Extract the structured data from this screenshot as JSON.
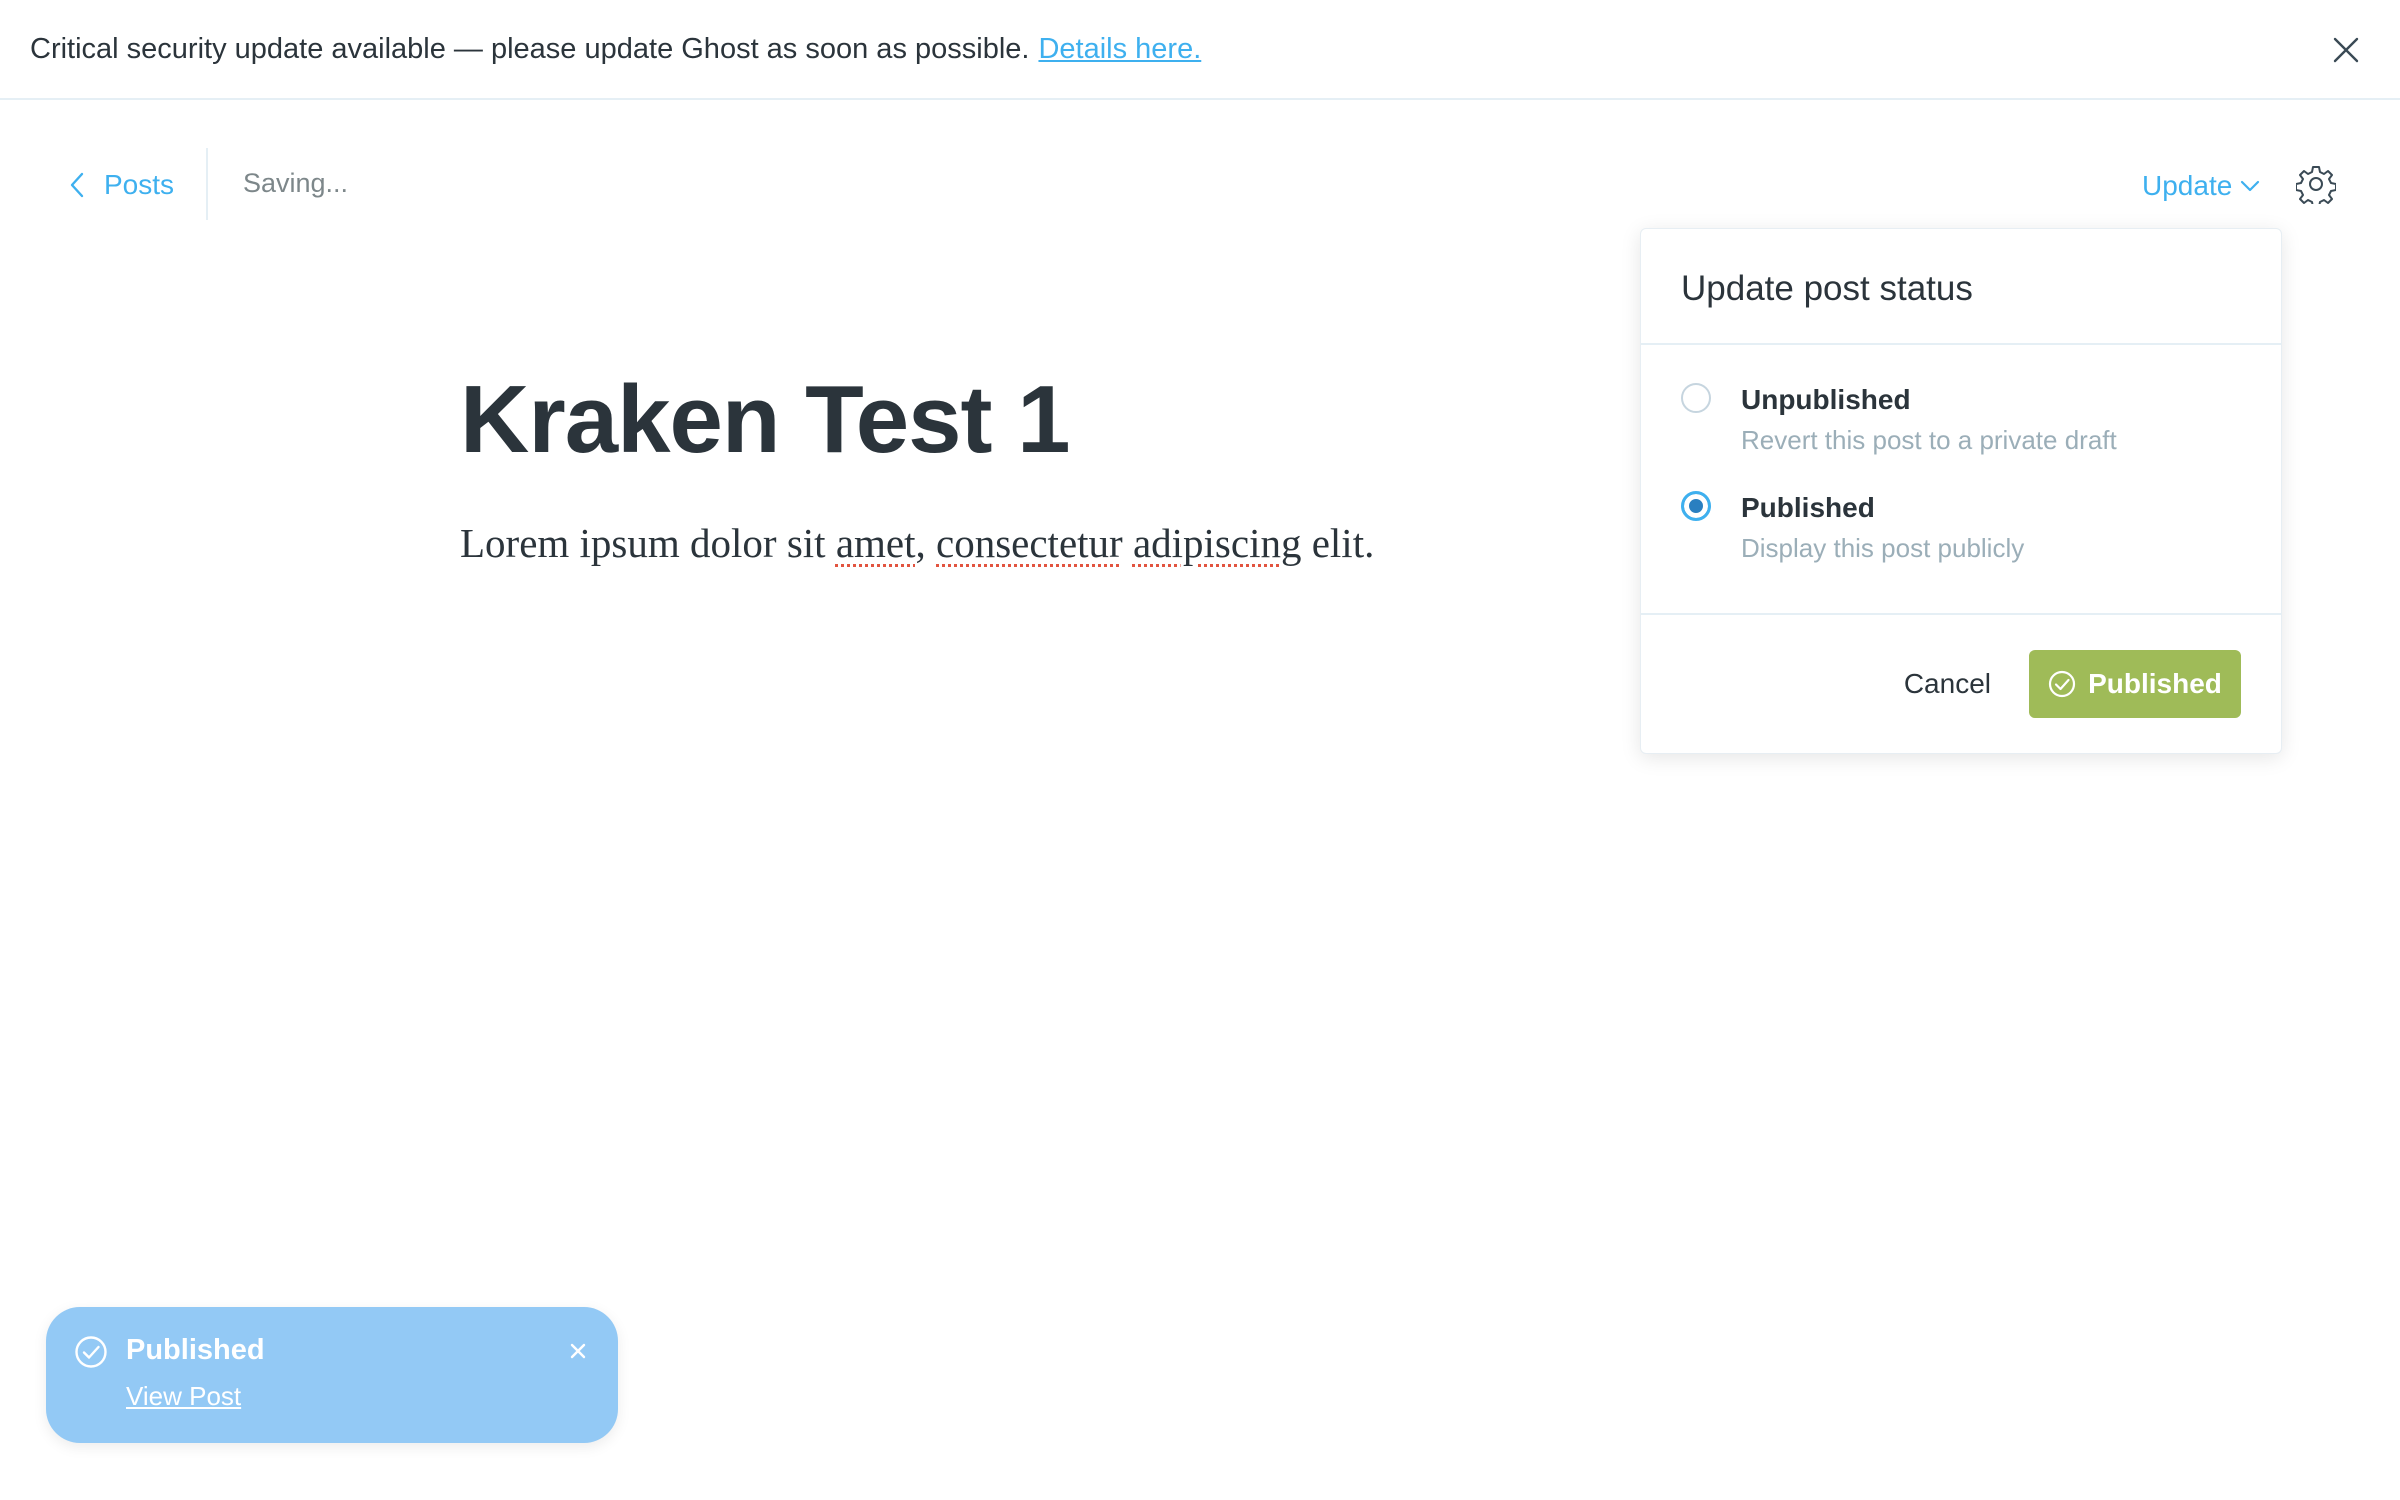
{
  "banner": {
    "message": "Critical security update available — please update Ghost as soon as possible.",
    "link_text": "Details here.",
    "close_icon": "close-icon"
  },
  "topbar": {
    "back_label": "Posts",
    "status_text": "Saving...",
    "update_label": "Update",
    "settings_icon": "gear-icon"
  },
  "editor": {
    "title": "Kraken Test 1",
    "body_parts": [
      "Lorem ipsum dolor sit ",
      "amet",
      ", ",
      "consectetur",
      " ",
      "adipiscing",
      " elit."
    ]
  },
  "popover": {
    "title": "Update post status",
    "options": [
      {
        "label": "Unpublished",
        "description": "Revert this post to a private draft",
        "selected": false
      },
      {
        "label": "Published",
        "description": "Display this post publicly",
        "selected": true
      }
    ],
    "cancel_label": "Cancel",
    "confirm_label": "Published"
  },
  "toast": {
    "title": "Published",
    "link_text": "View Post"
  },
  "colors": {
    "accent": "#3eb0ef",
    "success": "#9fbb58",
    "toast": "#93c9f5",
    "text": "#2b343b"
  }
}
